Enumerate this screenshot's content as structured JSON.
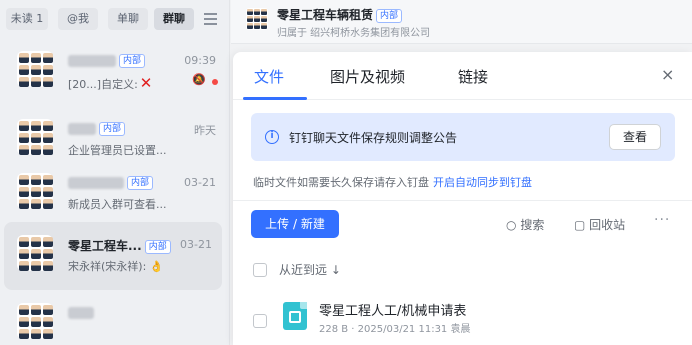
{
  "filters": [
    {
      "label": "未读 1",
      "active": false
    },
    {
      "label": "@我",
      "active": false
    },
    {
      "label": "单聊",
      "active": false
    },
    {
      "label": "群聊",
      "active": true
    }
  ],
  "conversations": [
    {
      "badge": "内部",
      "time": "09:39",
      "preview": "[20...]自定义:"
    },
    {
      "badge": "内部",
      "time": "昨天",
      "preview": "企业管理员已设置..."
    },
    {
      "badge": "内部",
      "time": "03-21",
      "preview": "新成员入群可查看..."
    },
    {
      "name": "零星工程车...",
      "badge": "内部",
      "time": "03-21",
      "preview": "宋永祥(宋永祥):",
      "emoji": "👌"
    }
  ],
  "chat_header": {
    "title": "零星工程车辆租赁",
    "badge": "内部",
    "subtitle": "归属于 绍兴柯桥水务集团有限公司"
  },
  "panel": {
    "tabs": [
      "文件",
      "图片及视频",
      "链接"
    ],
    "close_glyph": "×",
    "notice": {
      "icon": "i",
      "text": "钉钉聊天文件保存规则调整公告",
      "button": "查看"
    },
    "temp_note": "临时文件如需要长久保存请存入钉盘",
    "temp_link": "开启自动同步到钉盘",
    "upload_label": "上传 / 新建",
    "search_label": "搜索",
    "search_icon": "○",
    "recycle_label": "回收站",
    "recycle_icon": "▢",
    "more_glyph": "···",
    "sort_label": "从近到远 ↓",
    "files": [
      {
        "name": "零星工程人工/机械申请表",
        "meta": "228 B · 2025/03/21 11:31 袁晨"
      }
    ]
  },
  "colors": {
    "accent": "#3370ff",
    "notice_bg": "#e1eaff",
    "badge_border": "#9bb9ff"
  }
}
